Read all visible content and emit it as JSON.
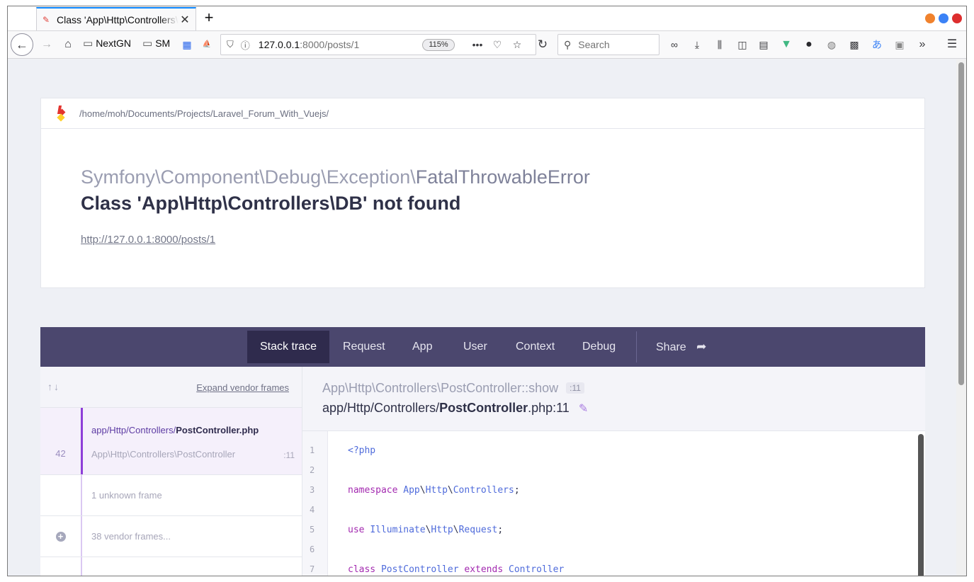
{
  "browser": {
    "tab_title": "Class 'App\\Http\\Controllers\\DB' not found",
    "tab_close": "✕",
    "new_tab": "+",
    "window_dots": [
      "#f0822d",
      "#3b82f6",
      "#dd2e2e"
    ],
    "bookmarks": [
      "NextGN",
      "SM"
    ],
    "url_host": "127.0.0.1",
    "url_path": ":8000/posts/1",
    "zoom": "115%",
    "search_placeholder": "Search"
  },
  "card": {
    "project_path": "/home/moh/Documents/Projects/Laravel_Forum_With_Vuejs/",
    "exception_namespace": "Symfony\\Component\\Debug\\Exception\\",
    "exception_class": "FatalThrowableError",
    "message": "Class 'App\\Http\\Controllers\\DB' not found",
    "url": "http://127.0.0.1:8000/posts/1"
  },
  "tabs": [
    {
      "label": "Stack trace"
    },
    {
      "label": "Request"
    },
    {
      "label": "App"
    },
    {
      "label": "User"
    },
    {
      "label": "Context"
    },
    {
      "label": "Debug"
    },
    {
      "label": "Share"
    }
  ],
  "frames": {
    "expand_label": "Expand vendor frames",
    "frame1": {
      "number": "42",
      "file_prefix": "app/Http/Controllers/",
      "file_name": "PostController.php",
      "class": "App\\Http\\Controllers\\PostController",
      "line": ":11"
    },
    "unknown": "1 unknown frame",
    "vendor": "38 vendor frames..."
  },
  "detail": {
    "method_prefix": "App\\Http\\Controllers\\PostController",
    "method_name": "::show",
    "line_badge": ":11",
    "path_prefix": "app/Http/Controllers/",
    "path_file": "PostController",
    "path_suffix": ".php:11"
  },
  "code": {
    "lines": [
      {
        "n": "1",
        "text": "<?php"
      },
      {
        "n": "2",
        "text": ""
      },
      {
        "n": "3",
        "kw": "namespace",
        "ns": [
          "App",
          "Http",
          "Controllers"
        ],
        "end": ";"
      },
      {
        "n": "4",
        "text": ""
      },
      {
        "n": "5",
        "kw": "use",
        "ns": [
          "Illuminate",
          "Http",
          "Request"
        ],
        "end": ";"
      },
      {
        "n": "6",
        "text": ""
      },
      {
        "n": "7",
        "kw": "class",
        "cls": "PostController",
        "kw2": "extends",
        "parent": "Controller"
      }
    ]
  }
}
